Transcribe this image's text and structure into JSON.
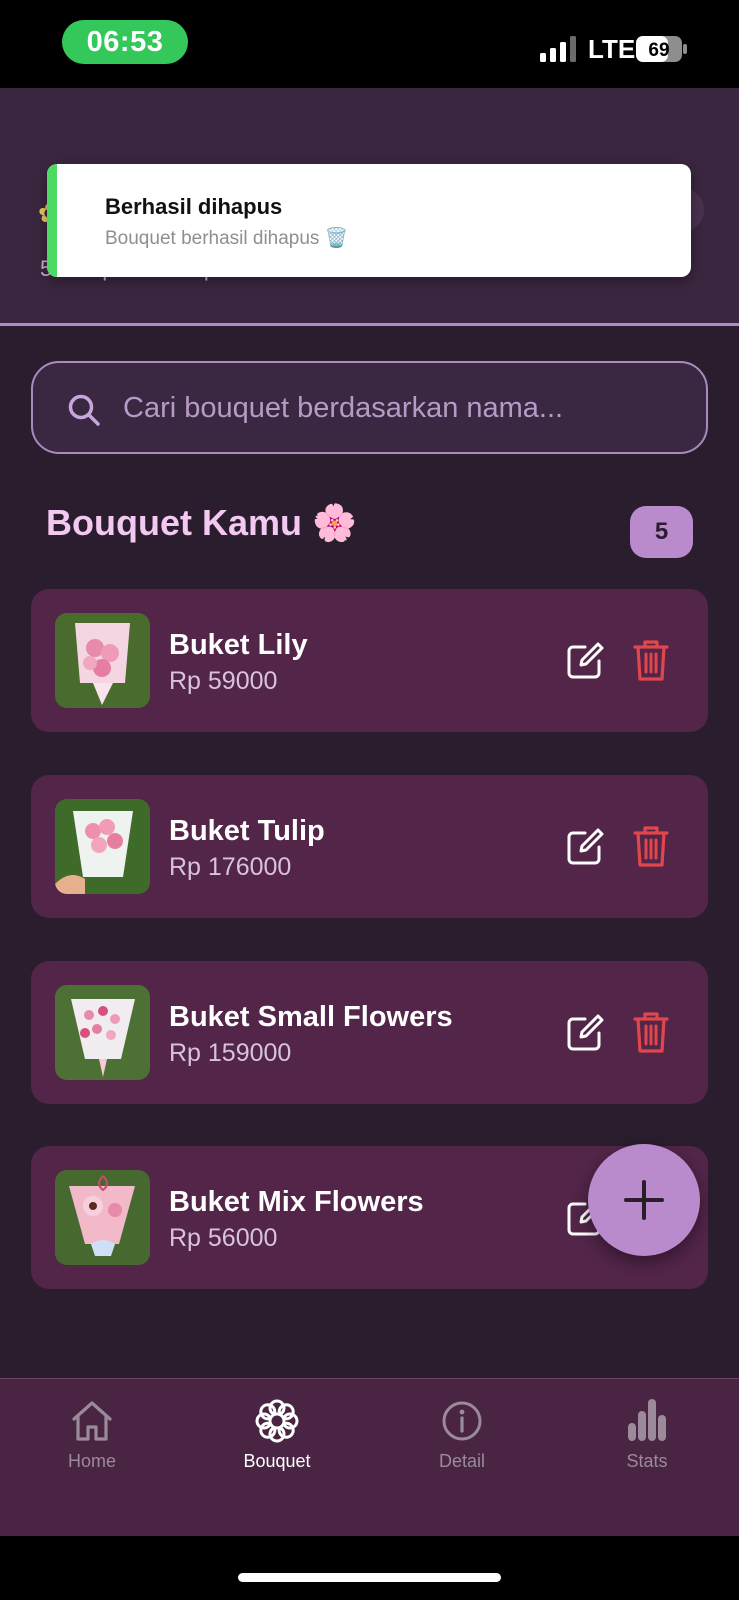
{
  "status_bar": {
    "time": "06:53",
    "network": "LTE",
    "battery": "69"
  },
  "header": {
    "subtitle": "5 bouquet tersimpan"
  },
  "toast": {
    "title": "Berhasil dihapus",
    "message": "Bouquet berhasil dihapus 🗑️"
  },
  "search": {
    "placeholder": "Cari bouquet berdasarkan nama...",
    "value": ""
  },
  "section": {
    "title": "Bouquet Kamu 🌸",
    "count": "5"
  },
  "bouquets": [
    {
      "name": "Buket Lily",
      "price": "Rp 59000"
    },
    {
      "name": "Buket Tulip",
      "price": "Rp 176000"
    },
    {
      "name": "Buket Small Flowers",
      "price": "Rp 159000"
    },
    {
      "name": "Buket Mix Flowers",
      "price": "Rp 56000"
    }
  ],
  "nav": [
    {
      "label": "Home",
      "icon": "home-icon",
      "active": false
    },
    {
      "label": "Bouquet",
      "icon": "flower-icon",
      "active": true
    },
    {
      "label": "Detail",
      "icon": "info-icon",
      "active": false
    },
    {
      "label": "Stats",
      "icon": "bar-chart-icon",
      "active": false
    }
  ],
  "colors": {
    "accent": "#b98bcd",
    "delete": "#e0474c",
    "card": "#522549",
    "background": "#2a1d2e",
    "toast_bar": "#4cd964"
  }
}
